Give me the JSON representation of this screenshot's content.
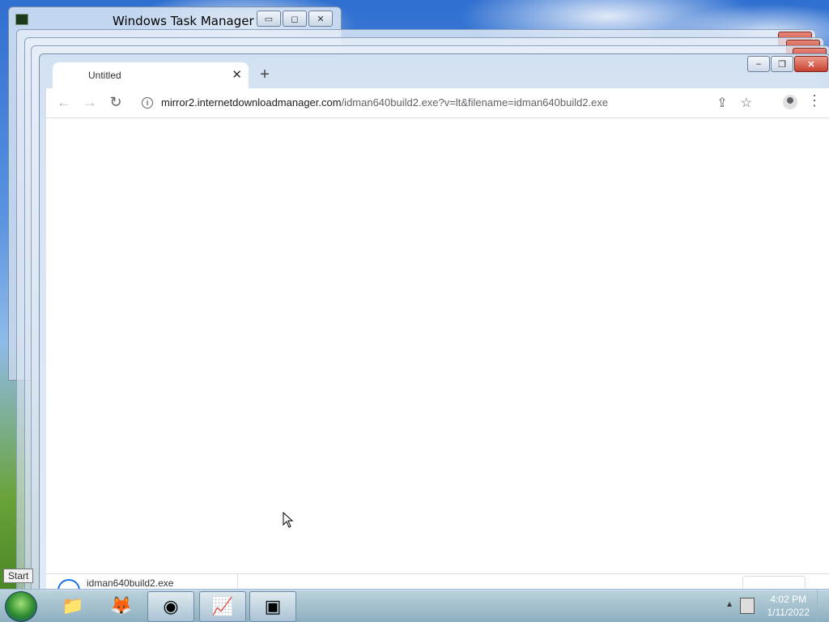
{
  "taskmanager": {
    "title": "Windows Task Manager",
    "minimize": "▭",
    "maximize": "◻",
    "close": "✕"
  },
  "browser": {
    "tab": {
      "title": "Untitled",
      "close": "✕"
    },
    "new_tab": "+",
    "nav": {
      "back": "←",
      "forward": "→",
      "reload": "↻"
    },
    "url_host": "mirror2.internetdownloadmanager.com",
    "url_path": "/idman640build2.exe?v=lt&filename=idman640build2.exe",
    "share_icon": "⇪",
    "star_icon": "☆",
    "menu": "⋮",
    "window": {
      "minimize": "–",
      "maximize": "❐",
      "close": "✕"
    },
    "download": {
      "filename": "idman640build2.exe"
    }
  },
  "taskbar": {
    "start_tooltip": "Start",
    "items": [
      {
        "name": "file-explorer",
        "icon": "📁"
      },
      {
        "name": "firefox",
        "icon": "🦊"
      },
      {
        "name": "chrome",
        "icon": "◉"
      },
      {
        "name": "task-manager",
        "icon": "📈"
      },
      {
        "name": "virtualbox",
        "icon": "▣"
      }
    ],
    "tray_arrow": "▲",
    "time": "4:02 PM",
    "date": "1/11/2022"
  }
}
